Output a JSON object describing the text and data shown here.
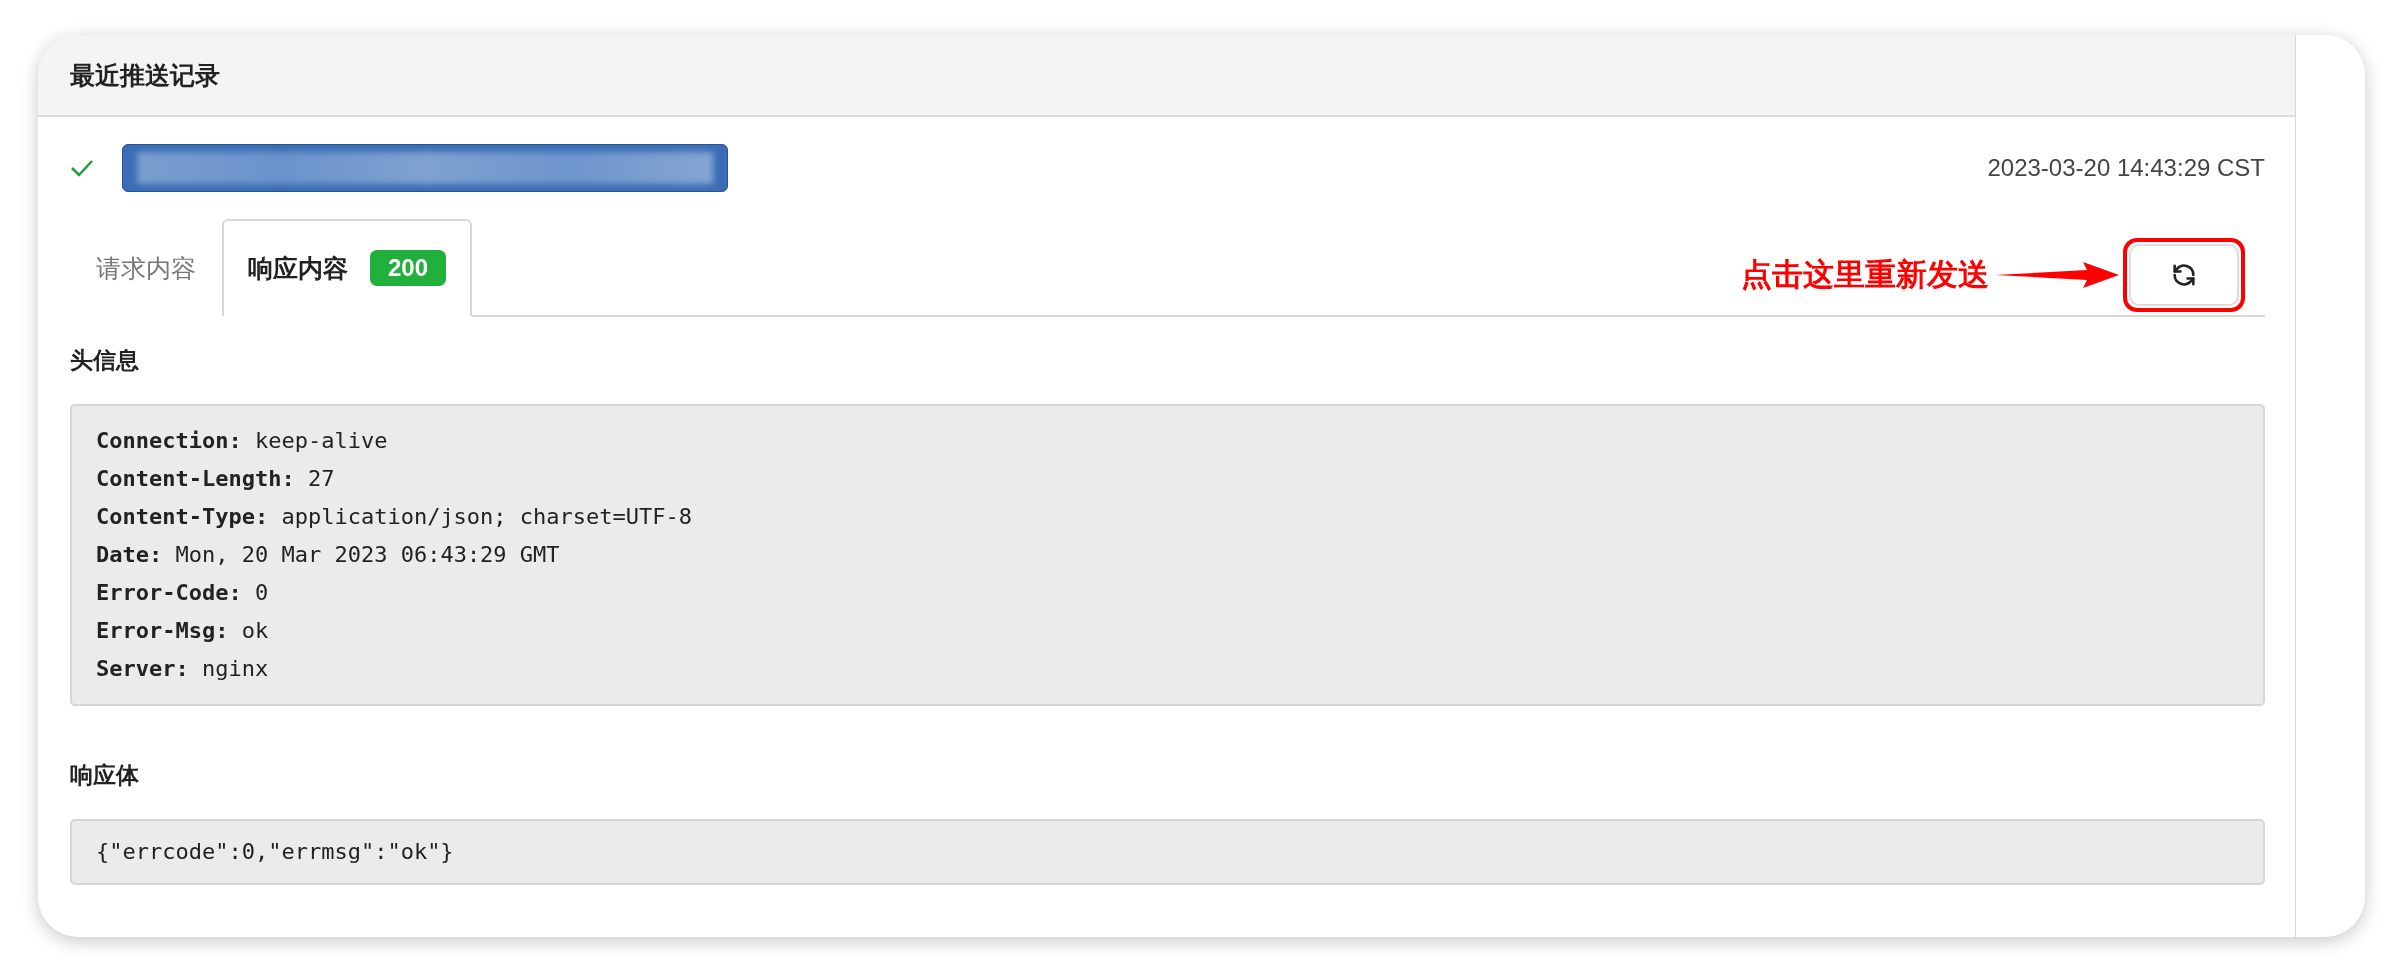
{
  "panel": {
    "title": "最近推送记录"
  },
  "record": {
    "success": true,
    "time": "2023-03-20 14:43:29 CST"
  },
  "tabs": [
    {
      "label": "请求内容",
      "selected": false
    },
    {
      "label": "响应内容",
      "selected": true,
      "badge": "200"
    }
  ],
  "annotation": {
    "text": "点击这里重新发送"
  },
  "headers_section": {
    "title": "头信息",
    "lines": [
      {
        "name": "Connection:",
        "value": "keep-alive"
      },
      {
        "name": "Content-Length:",
        "value": "27"
      },
      {
        "name": "Content-Type:",
        "value": "application/json; charset=UTF-8"
      },
      {
        "name": "Date:",
        "value": "Mon, 20 Mar 2023 06:43:29 GMT"
      },
      {
        "name": "Error-Code:",
        "value": "0"
      },
      {
        "name": "Error-Msg:",
        "value": "ok"
      },
      {
        "name": "Server:",
        "value": "nginx"
      }
    ]
  },
  "body_section": {
    "title": "响应体",
    "content": "{\"errcode\":0,\"errmsg\":\"ok\"}"
  }
}
